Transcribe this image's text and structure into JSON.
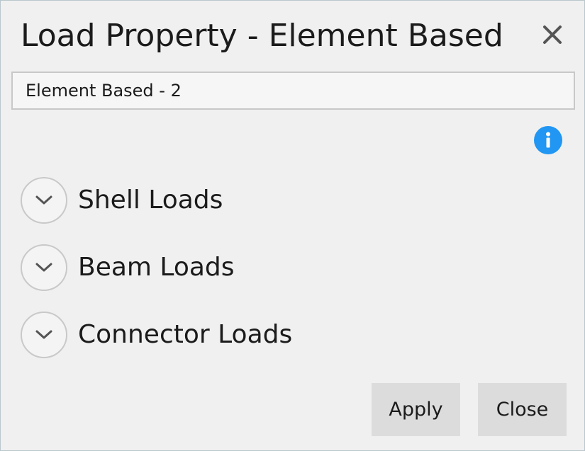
{
  "dialog": {
    "title": "Load Property - Element Based",
    "name_value": "Element Based - 2",
    "sections": [
      {
        "label": "Shell Loads"
      },
      {
        "label": "Beam Loads"
      },
      {
        "label": "Connector Loads"
      }
    ],
    "buttons": {
      "apply_label": "Apply",
      "close_label": "Close"
    },
    "icons": {
      "close": "close-icon",
      "info": "info-icon",
      "expand": "chevron-down-icon"
    },
    "colors": {
      "background": "#f0f0f0",
      "info_accent": "#2196f3",
      "button_bg": "#dcdcdc"
    }
  }
}
